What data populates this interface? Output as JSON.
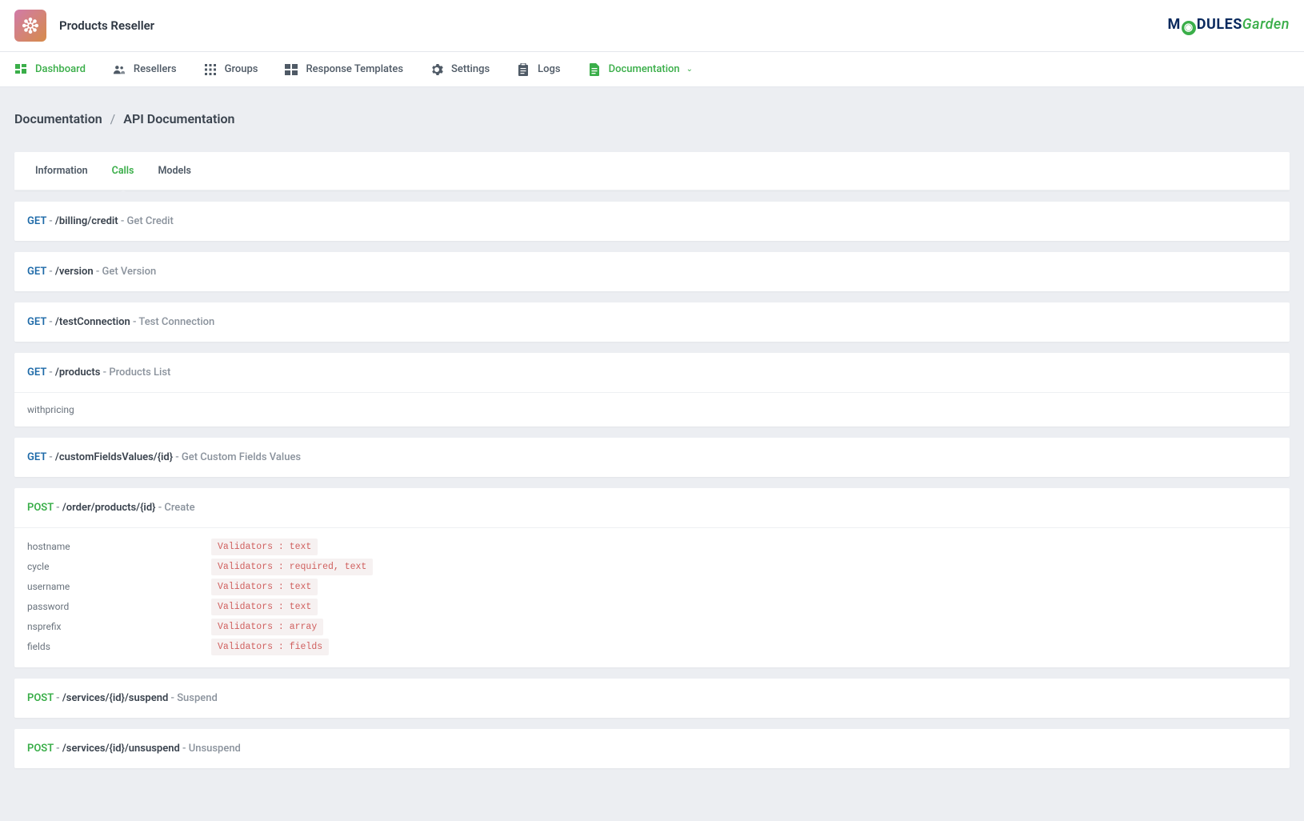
{
  "app": {
    "title": "Products Reseller"
  },
  "brand": {
    "m": "M",
    "odules": "DULES",
    "garden": "Garden"
  },
  "nav": {
    "dashboard": "Dashboard",
    "resellers": "Resellers",
    "groups": "Groups",
    "response_templates": "Response Templates",
    "settings": "Settings",
    "logs": "Logs",
    "documentation": "Documentation"
  },
  "breadcrumb": {
    "a": "Documentation",
    "b": "API Documentation"
  },
  "tabs": {
    "information": "Information",
    "calls": "Calls",
    "models": "Models"
  },
  "endpoints": [
    {
      "method": "GET",
      "path": "/billing/credit",
      "desc": "Get Credit"
    },
    {
      "method": "GET",
      "path": "/version",
      "desc": "Get Version"
    },
    {
      "method": "GET",
      "path": "/testConnection",
      "desc": "Test Connection"
    },
    {
      "method": "GET",
      "path": "/products",
      "desc": "Products List",
      "body_single": "withpricing"
    },
    {
      "method": "GET",
      "path": "/customFieldsValues/{id}",
      "desc": "Get Custom Fields Values"
    },
    {
      "method": "POST",
      "path": "/order/products/{id}",
      "desc": "Create",
      "params": [
        {
          "name": "hostname",
          "validator": "Validators : text"
        },
        {
          "name": "cycle",
          "validator": "Validators : required, text"
        },
        {
          "name": "username",
          "validator": "Validators : text"
        },
        {
          "name": "password",
          "validator": "Validators : text"
        },
        {
          "name": "nsprefix",
          "validator": "Validators : array"
        },
        {
          "name": "fields",
          "validator": "Validators : fields"
        }
      ]
    },
    {
      "method": "POST",
      "path": "/services/{id}/suspend",
      "desc": "Suspend"
    },
    {
      "method": "POST",
      "path": "/services/{id}/unsuspend",
      "desc": "Unsuspend"
    }
  ]
}
